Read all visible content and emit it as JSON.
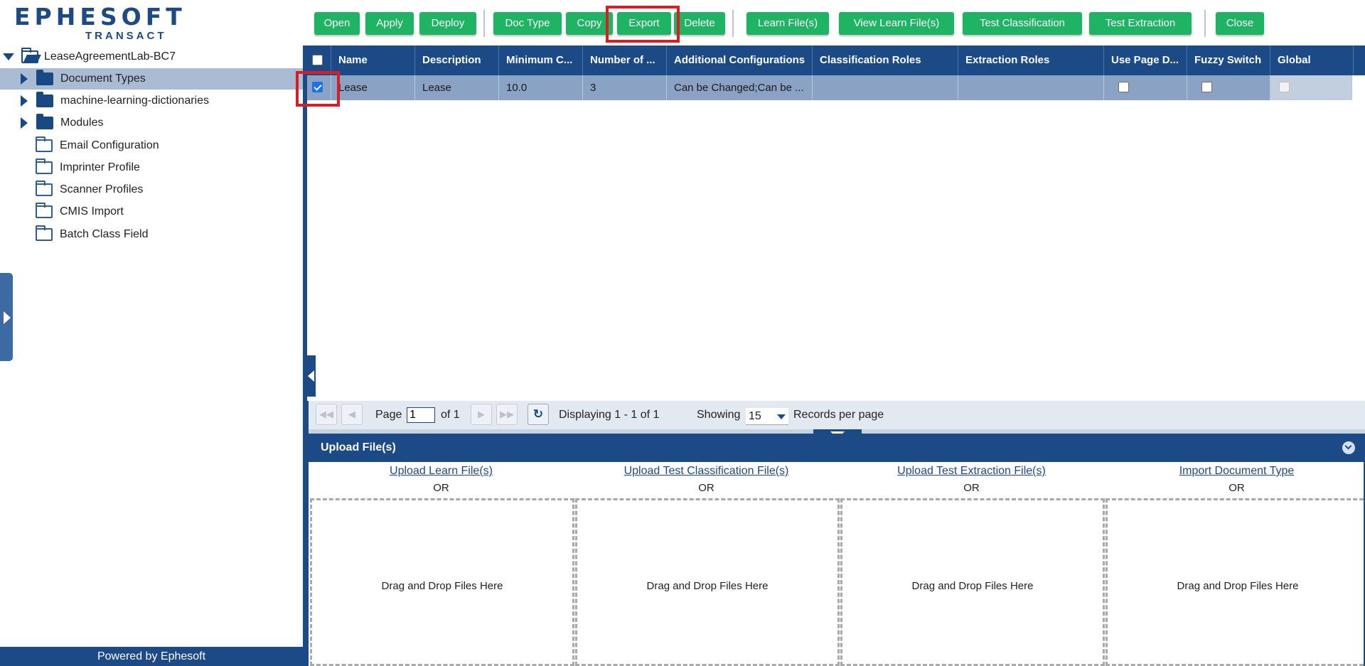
{
  "brand": {
    "logo_word": "EPHESOFT",
    "logo_sub": "TRANSACT"
  },
  "tree": {
    "root": "LeaseAgreementLab-BC7",
    "items": [
      {
        "label": "Document Types",
        "icon": "folder-filled-icon"
      },
      {
        "label": "machine-learning-dictionaries",
        "icon": "folder-filled-icon"
      },
      {
        "label": "Modules",
        "icon": "folder-filled-icon"
      },
      {
        "label": "Email Configuration",
        "icon": "folder-outline-icon"
      },
      {
        "label": "Imprinter Profile",
        "icon": "folder-outline-icon"
      },
      {
        "label": "Scanner Profiles",
        "icon": "folder-outline-icon"
      },
      {
        "label": "CMIS Import",
        "icon": "folder-outline-icon"
      },
      {
        "label": "Batch Class Field",
        "icon": "folder-outline-icon"
      }
    ],
    "selected": "Document Types"
  },
  "footer": "Powered by Ephesoft",
  "toolbar": {
    "open": "Open",
    "apply": "Apply",
    "deploy": "Deploy",
    "doc_type": "Doc Type",
    "copy": "Copy",
    "export": "Export",
    "delete": "Delete",
    "learn_files": "Learn File(s)",
    "view_learn_files": "View Learn File(s)",
    "test_classification": "Test Classification",
    "test_extraction": "Test Extraction",
    "close": "Close"
  },
  "grid": {
    "columns": [
      "Name",
      "Description",
      "Minimum C...",
      "Number of ...",
      "Additional Configurations",
      "Classification Roles",
      "Extraction Roles",
      "Use Page D...",
      "Fuzzy Switch",
      "Global"
    ],
    "rows": [
      {
        "checked": true,
        "name": "Lease",
        "description": "Lease",
        "minimum_confidence": "10.0",
        "number_of": "3",
        "additional_configurations": "Can be Changed;Can be ...",
        "classification_roles": "",
        "extraction_roles": "",
        "use_page": false,
        "fuzzy_switch": false,
        "global": false
      }
    ]
  },
  "pager": {
    "page_label": "Page",
    "page_value": "1",
    "of_label": "of 1",
    "displaying": "Displaying 1 - 1 of 1",
    "showing_label": "Showing",
    "per_page": "15",
    "records_label": "Records per page"
  },
  "upload": {
    "title": "Upload File(s)",
    "or_label": "OR",
    "drop_label": "Drag and Drop Files Here",
    "links": [
      "Upload Learn File(s)",
      "Upload Test Classification File(s)",
      "Upload Test Extraction File(s)",
      "Import Document Type"
    ]
  },
  "colors": {
    "brand_blue": "#1b4a86",
    "button_green": "#1fb463",
    "highlight_red": "#d81e24",
    "selected_row": "#8aa2c4"
  }
}
